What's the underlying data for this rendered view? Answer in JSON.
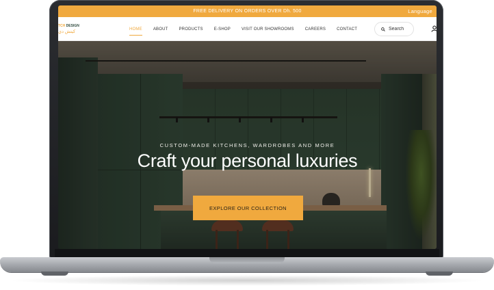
{
  "promo_bar": {
    "text": "FREE DELIVERY ON ORDERS OVER Dh. 500",
    "language_label": "Language",
    "color": "#f0a93e"
  },
  "logo": {
    "top_text_accent": "TCH",
    "top_text": " DESIGN",
    "bottom_text": "كيتش دي"
  },
  "nav": {
    "items": [
      {
        "label": "HOME",
        "active": true
      },
      {
        "label": "ABOUT"
      },
      {
        "label": "PRODUCTS"
      },
      {
        "label": "E-SHOP"
      },
      {
        "label": "VISIT OUR SHOWROOMS"
      },
      {
        "label": "CAREERS"
      },
      {
        "label": "CONTACT"
      }
    ],
    "search": {
      "placeholder": "Search",
      "icon": "search-icon"
    },
    "user_icon": "user-icon"
  },
  "hero": {
    "eyebrow": "CUSTOM-MADE KITCHENS, WARDROBES AND MORE",
    "title": "Craft your personal luxuries",
    "cta_label": "EXPLORE OUR COLLECTION",
    "accent_color": "#f0a93e",
    "cabinet_color": "#2f4636"
  }
}
